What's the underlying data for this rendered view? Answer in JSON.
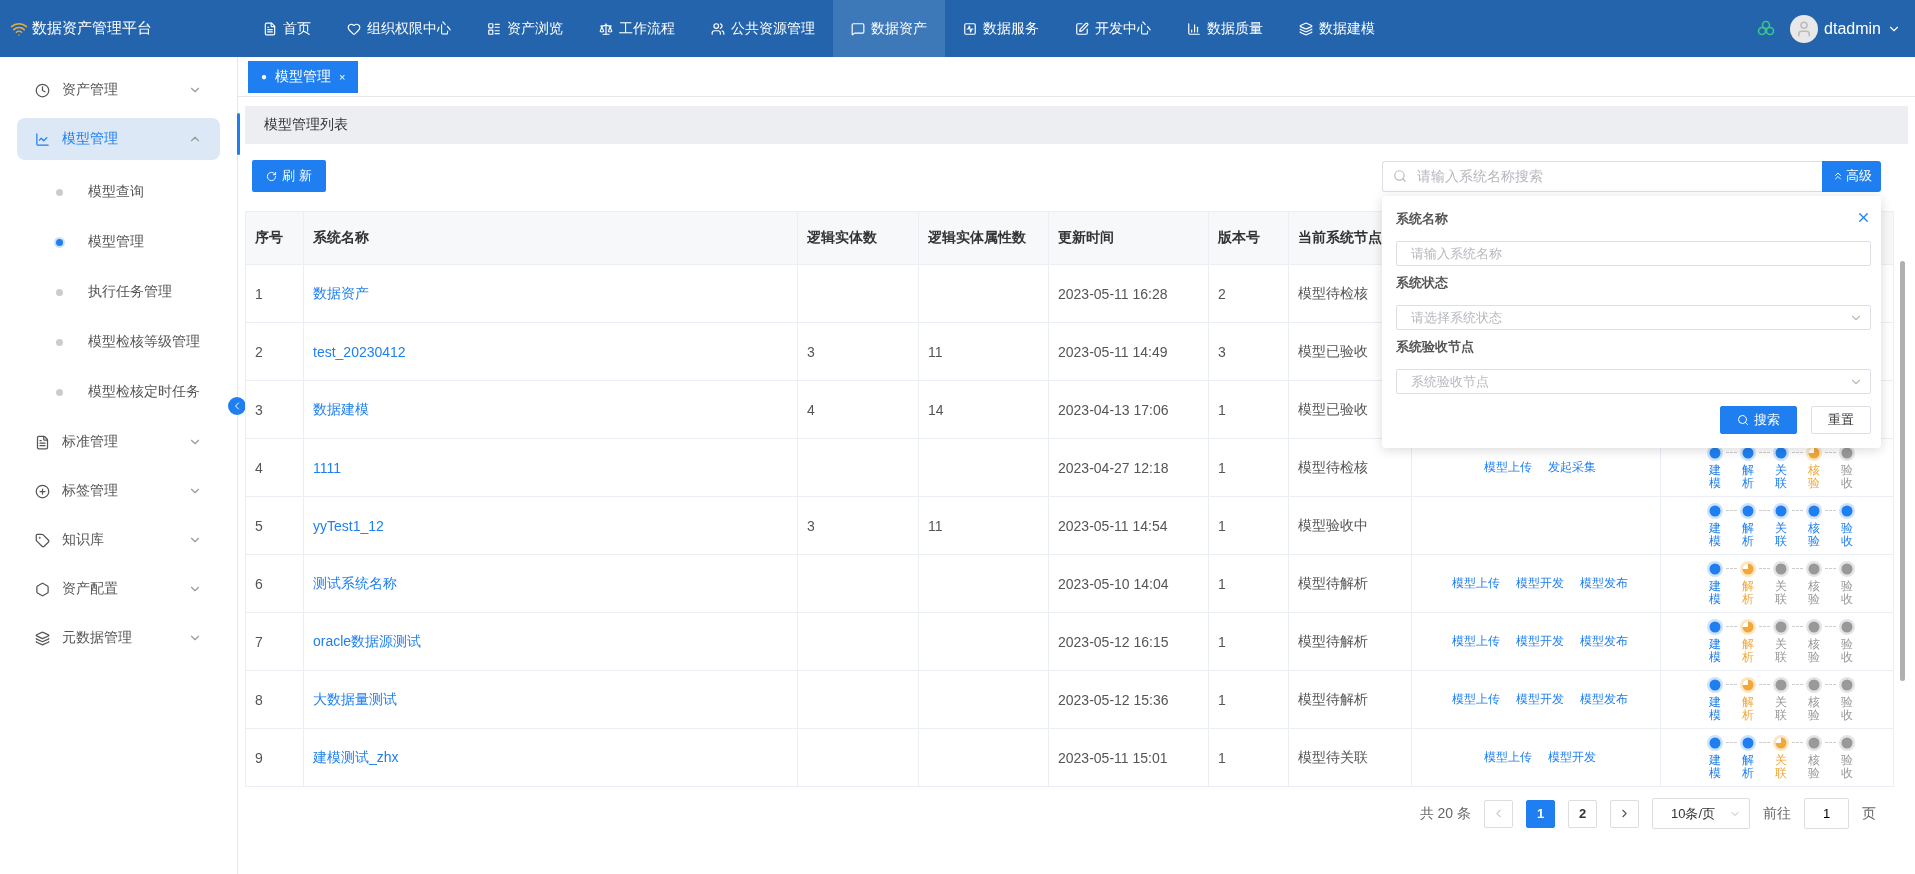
{
  "brand": "数据资产管理平台",
  "nav": [
    {
      "label": "首页",
      "selected": false
    },
    {
      "label": "组织权限中心",
      "selected": false
    },
    {
      "label": "资产浏览",
      "selected": false
    },
    {
      "label": "工作流程",
      "selected": false
    },
    {
      "label": "公共资源管理",
      "selected": false
    },
    {
      "label": "数据资产",
      "selected": true
    },
    {
      "label": "数据服务",
      "selected": false
    },
    {
      "label": "开发中心",
      "selected": false
    },
    {
      "label": "数据质量",
      "selected": false
    },
    {
      "label": "数据建模",
      "selected": false
    }
  ],
  "user": {
    "name": "dtadmin"
  },
  "sidebar": [
    {
      "label": "资产管理",
      "expanded": false,
      "selected": false
    },
    {
      "label": "模型管理",
      "expanded": true,
      "selected": true,
      "children": [
        {
          "label": "模型查询",
          "selected": false
        },
        {
          "label": "模型管理",
          "selected": true
        },
        {
          "label": "执行任务管理",
          "selected": false
        },
        {
          "label": "模型检核等级管理",
          "selected": false
        },
        {
          "label": "模型检核定时任务",
          "selected": false
        }
      ]
    },
    {
      "label": "标准管理",
      "expanded": false,
      "selected": false
    },
    {
      "label": "标签管理",
      "expanded": false,
      "selected": false
    },
    {
      "label": "知识库",
      "expanded": false,
      "selected": false
    },
    {
      "label": "资产配置",
      "expanded": false,
      "selected": false
    },
    {
      "label": "元数据管理",
      "expanded": false,
      "selected": false
    }
  ],
  "tabs": [
    {
      "label": "模型管理",
      "selected": true,
      "bullet": "●",
      "close": "×"
    }
  ],
  "section_title": "模型管理列表",
  "refresh_button": "刷 新",
  "search": {
    "placeholder": "请输入系统名称搜索",
    "advanced_button": "高级"
  },
  "advanced_panel": {
    "fields": [
      {
        "label": "系统名称",
        "placeholder": "请输入系统名称",
        "kind": "input"
      },
      {
        "label": "系统状态",
        "placeholder": "请选择系统状态",
        "kind": "select"
      },
      {
        "label": "系统验收节点",
        "placeholder": "系统验收节点",
        "kind": "select"
      }
    ],
    "search_button": "搜索",
    "reset_button": "重置"
  },
  "table": {
    "columns": [
      "序号",
      "系统名称",
      "逻辑实体数",
      "逻辑实体属性数",
      "更新时间",
      "版本号",
      "当前系统节点"
    ],
    "rows": [
      {
        "index": "1",
        "name": "数据资产",
        "entities": "",
        "attributes": "",
        "updated": "2023-05-11 16:28",
        "version": "2",
        "node": "模型待检核"
      },
      {
        "index": "2",
        "name": "test_20230412",
        "entities": "3",
        "attributes": "11",
        "updated": "2023-05-11 14:49",
        "version": "3",
        "node": "模型已验收"
      },
      {
        "index": "3",
        "name": "数据建模",
        "entities": "4",
        "attributes": "14",
        "updated": "2023-04-13 17:06",
        "version": "1",
        "node": "模型已验收"
      },
      {
        "index": "4",
        "name": "1111",
        "entities": "",
        "attributes": "",
        "updated": "2023-04-27 12:18",
        "version": "1",
        "node": "模型待检核",
        "actions": [
          "模型上传",
          "发起采集"
        ],
        "steps": [
          {
            "label": "建模",
            "done": true,
            "current": false
          },
          {
            "label": "解析",
            "done": true,
            "current": false
          },
          {
            "label": "关联",
            "done": true,
            "current": false
          },
          {
            "label": "核验",
            "done": false,
            "current": true
          },
          {
            "label": "验收",
            "done": false,
            "current": false
          }
        ]
      },
      {
        "index": "5",
        "name": "yyTest1_12",
        "entities": "3",
        "attributes": "11",
        "updated": "2023-05-11 14:54",
        "version": "1",
        "node": "模型验收中",
        "steps": [
          {
            "label": "建模",
            "done": true,
            "current": false
          },
          {
            "label": "解析",
            "done": true,
            "current": false
          },
          {
            "label": "关联",
            "done": true,
            "current": false
          },
          {
            "label": "核验",
            "done": true,
            "current": false
          },
          {
            "label": "验收",
            "done": true,
            "current": false
          }
        ]
      },
      {
        "index": "6",
        "name": "测试系统名称",
        "entities": "",
        "attributes": "",
        "updated": "2023-05-10 14:04",
        "version": "1",
        "node": "模型待解析",
        "actions": [
          "模型上传",
          "模型开发",
          "模型发布"
        ],
        "steps": [
          {
            "label": "建模",
            "done": true,
            "current": false
          },
          {
            "label": "解析",
            "done": false,
            "current": true
          },
          {
            "label": "关联",
            "done": false,
            "current": false
          },
          {
            "label": "核验",
            "done": false,
            "current": false
          },
          {
            "label": "验收",
            "done": false,
            "current": false
          }
        ]
      },
      {
        "index": "7",
        "name": "oracle数据源测试",
        "entities": "",
        "attributes": "",
        "updated": "2023-05-12 16:15",
        "version": "1",
        "node": "模型待解析",
        "actions": [
          "模型上传",
          "模型开发",
          "模型发布"
        ],
        "steps": [
          {
            "label": "建模",
            "done": true,
            "current": false
          },
          {
            "label": "解析",
            "done": false,
            "current": true
          },
          {
            "label": "关联",
            "done": false,
            "current": false
          },
          {
            "label": "核验",
            "done": false,
            "current": false
          },
          {
            "label": "验收",
            "done": false,
            "current": false
          }
        ]
      },
      {
        "index": "8",
        "name": "大数据量测试",
        "entities": "",
        "attributes": "",
        "updated": "2023-05-12 15:36",
        "version": "1",
        "node": "模型待解析",
        "actions": [
          "模型上传",
          "模型开发",
          "模型发布"
        ],
        "steps": [
          {
            "label": "建模",
            "done": true,
            "current": false
          },
          {
            "label": "解析",
            "done": false,
            "current": true
          },
          {
            "label": "关联",
            "done": false,
            "current": false
          },
          {
            "label": "核验",
            "done": false,
            "current": false
          },
          {
            "label": "验收",
            "done": false,
            "current": false
          }
        ]
      },
      {
        "index": "9",
        "name": "建模测试_zhx",
        "entities": "",
        "attributes": "",
        "updated": "2023-05-11 15:01",
        "version": "1",
        "node": "模型待关联",
        "actions": [
          "模型上传",
          "模型开发"
        ],
        "steps": [
          {
            "label": "建模",
            "done": true,
            "current": false
          },
          {
            "label": "解析",
            "done": true,
            "current": false
          },
          {
            "label": "关联",
            "done": false,
            "current": true
          },
          {
            "label": "核验",
            "done": false,
            "current": false
          },
          {
            "label": "验收",
            "done": false,
            "current": false
          }
        ]
      }
    ]
  },
  "pagination": {
    "total": "共 20 条",
    "pages": [
      {
        "label": "1",
        "selected": true
      },
      {
        "label": "2",
        "selected": false
      }
    ],
    "page_size": "10条/页",
    "goto_label": "前往",
    "goto_value": "1",
    "goto_suffix": "页"
  }
}
